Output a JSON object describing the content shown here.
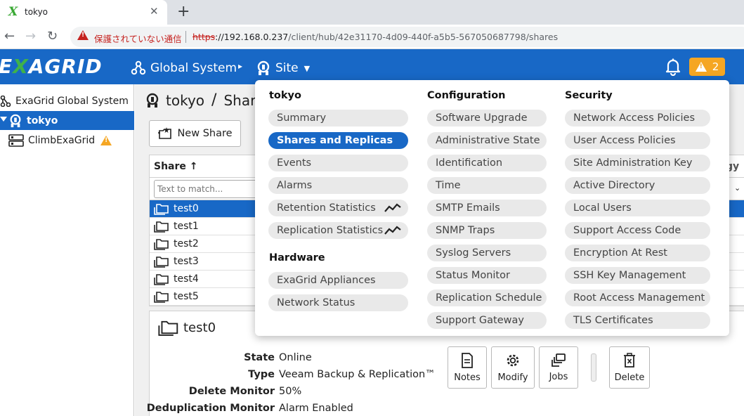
{
  "browser": {
    "tab_title": "tokyo",
    "tab_favicon": "X",
    "close_glyph": "✕",
    "new_tab_glyph": "+",
    "back_glyph": "←",
    "forward_glyph": "→",
    "reload_glyph": "↻",
    "insecure_label": "保護されていない通信",
    "url_scheme": "https",
    "url_host": "://192.168.0.237",
    "url_path": "/client/hub/42e31170-4d09-440f-a5b5-567050687798/shares"
  },
  "header": {
    "logo_pre": "E",
    "logo_x": "X",
    "logo_post": "AGRID",
    "global_label": "Global System",
    "sep_glyph": "▸",
    "site_label": "Site",
    "caret_glyph": "▼",
    "alarm_count": "2",
    "accent_color": "#1868c6",
    "warning_color": "#f5a623"
  },
  "tree": {
    "global": "ExaGrid Global System",
    "site": "tokyo",
    "appliance": "ClimbExaGrid"
  },
  "main": {
    "site_name": "tokyo",
    "section_partial": "Share",
    "new_share_label": "New Share",
    "column_share": "Share ↑",
    "column_partial_right": "gy",
    "filter_placeholder": "Text to match...",
    "filter_caret": "⌄",
    "shares": [
      "test0",
      "test1",
      "test2",
      "test3",
      "test4",
      "test5"
    ]
  },
  "detail": {
    "title": "test0",
    "props": [
      {
        "label": "State",
        "value": "Online"
      },
      {
        "label": "Type",
        "value": "Veeam Backup & Replication™"
      },
      {
        "label": "Delete Monitor",
        "value": "50%"
      },
      {
        "label": "Deduplication Monitor",
        "value": "Alarm Enabled"
      }
    ],
    "actions": {
      "notes": "Notes",
      "modify": "Modify",
      "jobs": "Jobs",
      "delete": "Delete"
    }
  },
  "menu": {
    "site_head": "tokyo",
    "site_items": [
      "Summary",
      "Shares and Replicas",
      "Events",
      "Alarms",
      "Retention Statistics",
      "Replication Statistics"
    ],
    "hardware_head": "Hardware",
    "hardware_items": [
      "ExaGrid Appliances",
      "Network Status"
    ],
    "config_head": "Configuration",
    "config_items": [
      "Software Upgrade",
      "Administrative State",
      "Identification",
      "Time",
      "SMTP Emails",
      "SNMP Traps",
      "Syslog Servers",
      "Status Monitor",
      "Replication Schedule",
      "Support Gateway"
    ],
    "security_head": "Security",
    "security_items": [
      "Network Access Policies",
      "User Access Policies",
      "Site Administration Key",
      "Active Directory",
      "Local Users",
      "Support Access Code",
      "Encryption At Rest",
      "SSH Key Management",
      "Root Access Management",
      "TLS Certificates"
    ]
  }
}
